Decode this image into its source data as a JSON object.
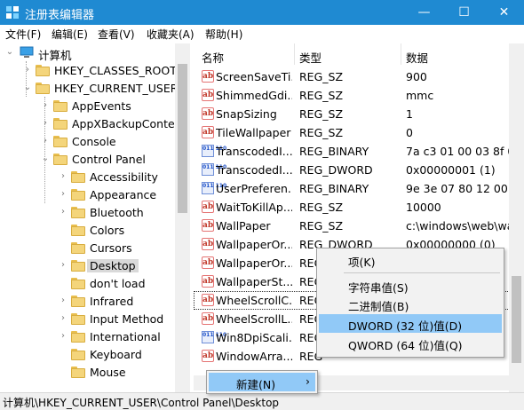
{
  "window": {
    "title": "注册表编辑器",
    "controls": {
      "minimize": "—",
      "maximize": "☐",
      "close": "✕"
    }
  },
  "menubar": [
    "文件(F)",
    "编辑(E)",
    "查看(V)",
    "收藏夹(A)",
    "帮助(H)"
  ],
  "tree": {
    "root": "计算机",
    "items": [
      {
        "label": "HKEY_CLASSES_ROOT",
        "arrow": "›"
      },
      {
        "label": "HKEY_CURRENT_USER",
        "arrow": "⌄"
      },
      {
        "label": "AppEvents",
        "arrow": "›"
      },
      {
        "label": "AppXBackupConter",
        "arrow": "›"
      },
      {
        "label": "Console",
        "arrow": "›"
      },
      {
        "label": "Control Panel",
        "arrow": "⌄"
      },
      {
        "label": "Accessibility",
        "arrow": "›"
      },
      {
        "label": "Appearance",
        "arrow": "›"
      },
      {
        "label": "Bluetooth",
        "arrow": "›"
      },
      {
        "label": "Colors",
        "arrow": ""
      },
      {
        "label": "Cursors",
        "arrow": ""
      },
      {
        "label": "Desktop",
        "arrow": "›"
      },
      {
        "label": "don't load",
        "arrow": ""
      },
      {
        "label": "Infrared",
        "arrow": "›"
      },
      {
        "label": "Input Method",
        "arrow": "›"
      },
      {
        "label": "International",
        "arrow": "›"
      },
      {
        "label": "Keyboard",
        "arrow": ""
      },
      {
        "label": "Mouse",
        "arrow": ""
      }
    ]
  },
  "list": {
    "headers": {
      "name": "名称",
      "type": "类型",
      "data": "数据"
    },
    "rows": [
      {
        "icon": "string-value-icon",
        "name": "ScreenSaveTi...",
        "type": "REG_SZ",
        "data": "900"
      },
      {
        "icon": "string-value-icon",
        "name": "ShimmedGdi...",
        "type": "REG_SZ",
        "data": "mmc"
      },
      {
        "icon": "string-value-icon",
        "name": "SnapSizing",
        "type": "REG_SZ",
        "data": "1"
      },
      {
        "icon": "string-value-icon",
        "name": "TileWallpaper",
        "type": "REG_SZ",
        "data": "0"
      },
      {
        "icon": "binary-value-icon",
        "name": "TranscodedI...",
        "type": "REG_BINARY",
        "data": "7a c3 01 00 03 8f 09"
      },
      {
        "icon": "binary-value-icon",
        "name": "TranscodedI...",
        "type": "REG_DWORD",
        "data": "0x00000001 (1)"
      },
      {
        "icon": "binary-value-icon",
        "name": "UserPreferen...",
        "type": "REG_BINARY",
        "data": "9e 3e 07 80 12 00 0"
      },
      {
        "icon": "string-value-icon",
        "name": "WaitToKillAp...",
        "type": "REG_SZ",
        "data": "10000"
      },
      {
        "icon": "string-value-icon",
        "name": "WallPaper",
        "type": "REG_SZ",
        "data": "c:\\windows\\web\\wa"
      },
      {
        "icon": "string-value-icon",
        "name": "WallpaperOr...",
        "type": "REG_DWORD",
        "data": "0x00000000 (0)"
      },
      {
        "icon": "string-value-icon",
        "name": "WallpaperOr...",
        "type": "REG",
        "data": ""
      },
      {
        "icon": "string-value-icon",
        "name": "WallpaperSt...",
        "type": "REG",
        "data": ""
      },
      {
        "icon": "string-value-icon",
        "name": "WheelScrollC...",
        "type": "REG",
        "data": ""
      },
      {
        "icon": "string-value-icon",
        "name": "WheelScrollL...",
        "type": "REG",
        "data": ""
      },
      {
        "icon": "binary-value-icon",
        "name": "Win8DpiScali...",
        "type": "REG",
        "data": ""
      },
      {
        "icon": "string-value-icon",
        "name": "WindowArra...",
        "type": "REG",
        "data": ""
      }
    ]
  },
  "context_menu_new": {
    "label": "新建(N)",
    "arrow": "›"
  },
  "context_submenu": {
    "items": [
      {
        "label": "项(K)"
      },
      {
        "label": "字符串值(S)"
      },
      {
        "label": "二进制值(B)"
      },
      {
        "label": "DWORD (32 位)值(D)"
      },
      {
        "label": "QWORD (64 位)值(Q)"
      }
    ]
  },
  "status": "计算机\\HKEY_CURRENT_USER\\Control Panel\\Desktop",
  "colors": {
    "titlebar": "#1f8ad2",
    "highlight": "#91c9f7",
    "folder": "#f4d57b"
  }
}
